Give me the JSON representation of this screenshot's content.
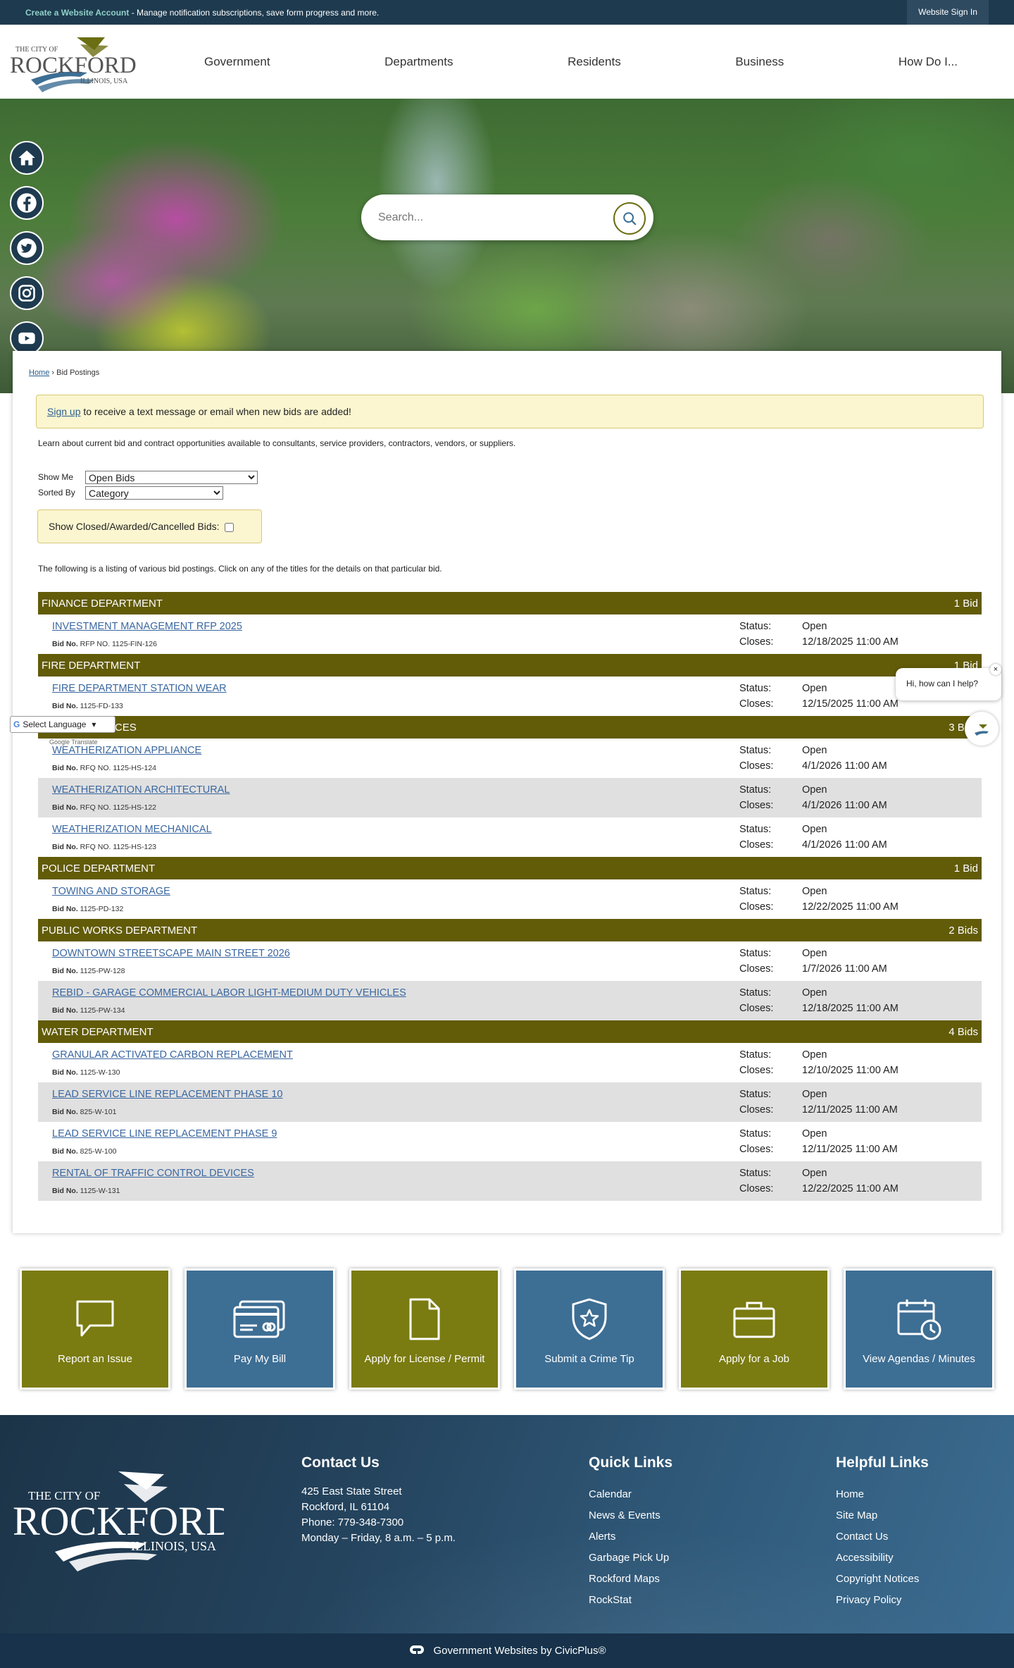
{
  "topbar": {
    "create_link": "Create a Website Account",
    "create_text": " - Manage notification subscriptions, save form progress and more.",
    "signin": "Website Sign In"
  },
  "logo": {
    "line1": "THE CITY OF",
    "line2": "ROCKFORD",
    "line3": "ILLINOIS, USA"
  },
  "nav": [
    "Government",
    "Departments",
    "Residents",
    "Business",
    "How Do I..."
  ],
  "search": {
    "placeholder": "Search..."
  },
  "breadcrumb": {
    "home": "Home",
    "sep": " › ",
    "current": "Bid Postings"
  },
  "signup": {
    "link": "Sign up",
    "text": " to receive a text message or email when new bids are added!"
  },
  "intro": "Learn about current bid and contract opportunities available to consultants, service providers, contractors, vendors, or suppliers.",
  "filters": {
    "show_label": "Show Me",
    "show_value": "Open Bids",
    "sort_label": "Sorted By",
    "sort_value": "Category",
    "closed_label": "Show Closed/Awarded/Cancelled Bids:"
  },
  "listing_text": "The following is a listing of various bid postings. Click on any of the titles for the details on that particular bid.",
  "labels": {
    "bid_no": "Bid No.",
    "status": "Status:",
    "closes": "Closes:"
  },
  "categories": [
    {
      "name": "FINANCE DEPARTMENT",
      "count": "1 Bid",
      "bids": [
        {
          "title": "INVESTMENT MANAGEMENT RFP 2025",
          "no": "RFP NO. 1125-FIN-126",
          "status": "Open",
          "closes": "12/18/2025 11:00 AM"
        }
      ]
    },
    {
      "name": "FIRE DEPARTMENT",
      "count": "1 Bid",
      "bids": [
        {
          "title": "FIRE DEPARTMENT STATION WEAR",
          "no": "1125-FD-133",
          "status": "Open",
          "closes": "12/15/2025 11:00 AM"
        }
      ]
    },
    {
      "name": "HUMAN SERVICES",
      "count": "3 Bids",
      "bids": [
        {
          "title": "WEATHERIZATION APPLIANCE",
          "no": "RFQ NO. 1125-HS-124",
          "status": "Open",
          "closes": "4/1/2026 11:00 AM"
        },
        {
          "title": "WEATHERIZATION ARCHITECTURAL",
          "no": "RFQ NO. 1125-HS-122",
          "status": "Open",
          "closes": "4/1/2026 11:00 AM"
        },
        {
          "title": "WEATHERIZATION MECHANICAL",
          "no": "RFQ NO. 1125-HS-123",
          "status": "Open",
          "closes": "4/1/2026 11:00 AM"
        }
      ]
    },
    {
      "name": "POLICE DEPARTMENT",
      "count": "1 Bid",
      "bids": [
        {
          "title": "TOWING AND STORAGE",
          "no": "1125-PD-132",
          "status": "Open",
          "closes": "12/22/2025 11:00 AM"
        }
      ]
    },
    {
      "name": "PUBLIC WORKS DEPARTMENT",
      "count": "2 Bids",
      "bids": [
        {
          "title": "DOWNTOWN STREETSCAPE MAIN STREET 2026",
          "no": "1125-PW-128",
          "status": "Open",
          "closes": "1/7/2026 11:00 AM"
        },
        {
          "title": "REBID - GARAGE COMMERCIAL LABOR LIGHT-MEDIUM DUTY VEHICLES",
          "no": "1125-PW-134",
          "status": "Open",
          "closes": "12/18/2025 11:00 AM"
        }
      ]
    },
    {
      "name": "WATER DEPARTMENT",
      "count": "4 Bids",
      "bids": [
        {
          "title": "GRANULAR ACTIVATED CARBON REPLACEMENT",
          "no": "1125-W-130",
          "status": "Open",
          "closes": "12/10/2025 11:00 AM"
        },
        {
          "title": "LEAD SERVICE LINE REPLACEMENT PHASE 10",
          "no": "825-W-101",
          "status": "Open",
          "closes": "12/11/2025 11:00 AM"
        },
        {
          "title": "LEAD SERVICE LINE REPLACEMENT PHASE 9",
          "no": "825-W-100",
          "status": "Open",
          "closes": "12/11/2025 11:00 AM"
        },
        {
          "title": "RENTAL OF TRAFFIC CONTROL DEVICES",
          "no": "1125-W-131",
          "status": "Open",
          "closes": "12/22/2025 11:00 AM"
        }
      ]
    }
  ],
  "translate": {
    "select": "Select Language",
    "powered": "Google Translate"
  },
  "chat": {
    "greeting": "Hi, how can I help?",
    "close": "×"
  },
  "tiles": [
    {
      "label": "Report an Issue",
      "icon": "speech-bubble-icon",
      "color": "olive"
    },
    {
      "label": "Pay My Bill",
      "icon": "credit-card-icon",
      "color": "blue"
    },
    {
      "label": "Apply for License / Permit",
      "icon": "document-icon",
      "color": "olive"
    },
    {
      "label": "Submit a Crime Tip",
      "icon": "badge-icon",
      "color": "blue"
    },
    {
      "label": "Apply for a Job",
      "icon": "briefcase-icon",
      "color": "olive"
    },
    {
      "label": "View Agendas / Minutes",
      "icon": "calendar-clock-icon",
      "color": "blue"
    }
  ],
  "footer": {
    "contact": {
      "heading": "Contact Us",
      "lines": [
        "425 East State Street",
        "Rockford, IL 61104",
        "Phone: 779-348-7300",
        "Monday – Friday, 8 a.m. – 5 p.m."
      ]
    },
    "quick": {
      "heading": "Quick Links",
      "links": [
        "Calendar",
        "News & Events",
        "Alerts",
        "Garbage Pick Up",
        "Rockford Maps",
        "RockStat"
      ]
    },
    "helpful": {
      "heading": "Helpful Links",
      "links": [
        "Home",
        "Site Map",
        "Contact Us",
        "Accessibility",
        "Copyright Notices",
        "Privacy Policy"
      ]
    },
    "credit": "Government Websites by CivicPlus®"
  },
  "colors": {
    "olive": "#625b08",
    "navy": "#1e3a4f",
    "link": "#3a67a0",
    "tile_blue": "#3d6e94",
    "tile_olive": "#7a7b10"
  }
}
